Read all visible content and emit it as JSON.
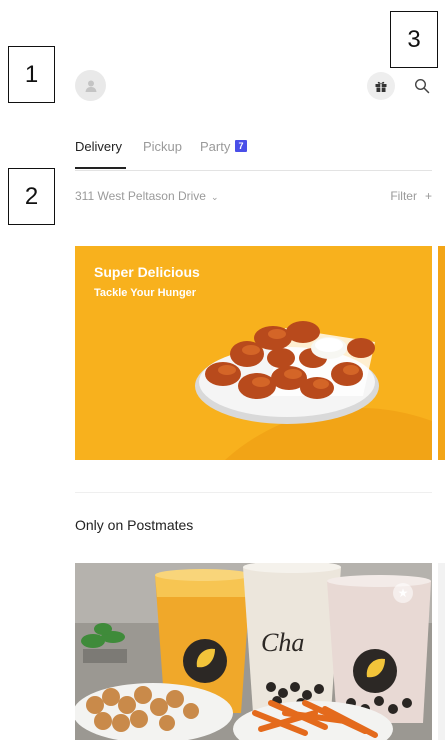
{
  "callouts": [
    "1",
    "2",
    "3"
  ],
  "header": {
    "avatar_icon": "user-icon",
    "gift_icon": "gift-icon",
    "search_icon": "search-icon"
  },
  "tabs": [
    {
      "label": "Delivery",
      "active": true
    },
    {
      "label": "Pickup",
      "active": false
    },
    {
      "label": "Party",
      "active": false,
      "badge": "7"
    }
  ],
  "location": {
    "address": "311 West Peltason Drive",
    "chevron": "⌄",
    "filter_label": "Filter",
    "filter_icon": "+"
  },
  "hero": {
    "title": "Super Delicious",
    "subtitle": "Tackle Your Hunger",
    "background_color": "#f8b11d"
  },
  "section": {
    "title": "Only on Postmates"
  },
  "promo": {
    "badge_icon": "star-icon",
    "badge_glyph": "★",
    "cup_logo_text": "Cha"
  },
  "colors": {
    "accent": "#4a4fe8",
    "hero_yellow": "#f8b11d",
    "muted_text": "#9a9a9a"
  }
}
